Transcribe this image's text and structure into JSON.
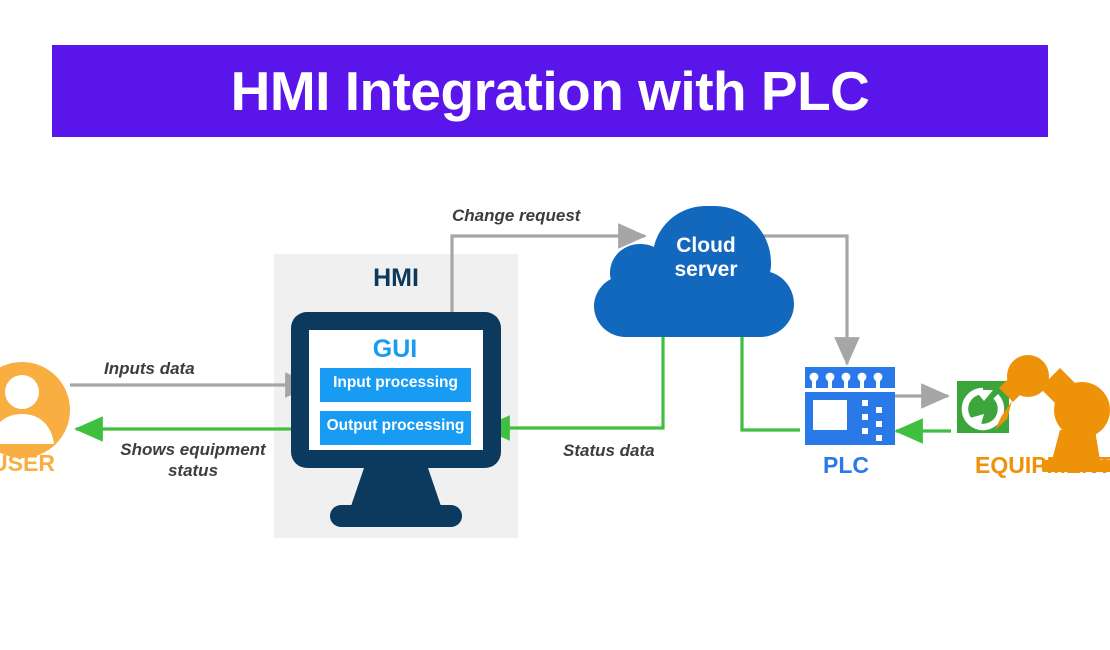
{
  "title": {
    "text": "HMI Integration with PLC",
    "banner_color": "#5A16EA",
    "text_color": "#ffffff"
  },
  "colors": {
    "purple_banner": "#5A16EA",
    "navy_monitor": "#0B3A5E",
    "bright_blue": "#189BF2",
    "cloud_blue": "#1268BD",
    "plc_blue": "#2979E8",
    "green_flow": "#3FBF3F",
    "gray_flow": "#A6A6A6",
    "orange_user": "#F9AE42",
    "orange_equipment": "#EE9209",
    "green_gear": "#3CA63C",
    "panel_gray": "#F0F0F0"
  },
  "nodes": {
    "user": {
      "label": "USER",
      "icon": "user-avatar-icon",
      "color": "#F9AE42"
    },
    "hmi": {
      "label": "HMI",
      "icon": "desktop-monitor-icon",
      "gui_label": "GUI",
      "blocks": [
        {
          "label": "Input processing",
          "name": "input-processing-block"
        },
        {
          "label": "Output processing",
          "name": "output-processing-block"
        }
      ]
    },
    "cloud": {
      "label_line1": "Cloud",
      "label_line2": "server",
      "icon": "cloud-icon",
      "color": "#1268BD"
    },
    "plc": {
      "label": "PLC",
      "icon": "plc-controller-icon",
      "color": "#2979E8"
    },
    "equipment": {
      "label": "EQUIPMENT",
      "icon": "robot-arm-icon",
      "gear_icon": "rotate-refresh-icon",
      "color": "#EE9209"
    }
  },
  "flows": [
    {
      "name": "user-to-hmi",
      "label": "Inputs data",
      "color": "#A6A6A6",
      "from": "user",
      "to": "input-processing-block"
    },
    {
      "name": "hmi-to-user",
      "label": "Shows equipment status",
      "color": "#3FBF3F",
      "from": "output-processing-block",
      "to": "user"
    },
    {
      "name": "hmi-to-cloud",
      "label": "Change request",
      "color": "#A6A6A6",
      "from": "input-processing-block",
      "to": "cloud"
    },
    {
      "name": "cloud-to-hmi",
      "label": "Status data",
      "color": "#3FBF3F",
      "from": "cloud",
      "to": "output-processing-block"
    },
    {
      "name": "cloud-to-plc",
      "label": "",
      "color": "#A6A6A6",
      "from": "cloud",
      "to": "plc"
    },
    {
      "name": "plc-to-cloud",
      "label": "",
      "color": "#3FBF3F",
      "from": "plc",
      "to": "cloud"
    },
    {
      "name": "plc-to-equipment",
      "label": "",
      "color": "#A6A6A6",
      "from": "plc",
      "to": "equipment"
    },
    {
      "name": "equipment-to-plc",
      "label": "",
      "color": "#3FBF3F",
      "from": "equipment",
      "to": "plc"
    }
  ]
}
